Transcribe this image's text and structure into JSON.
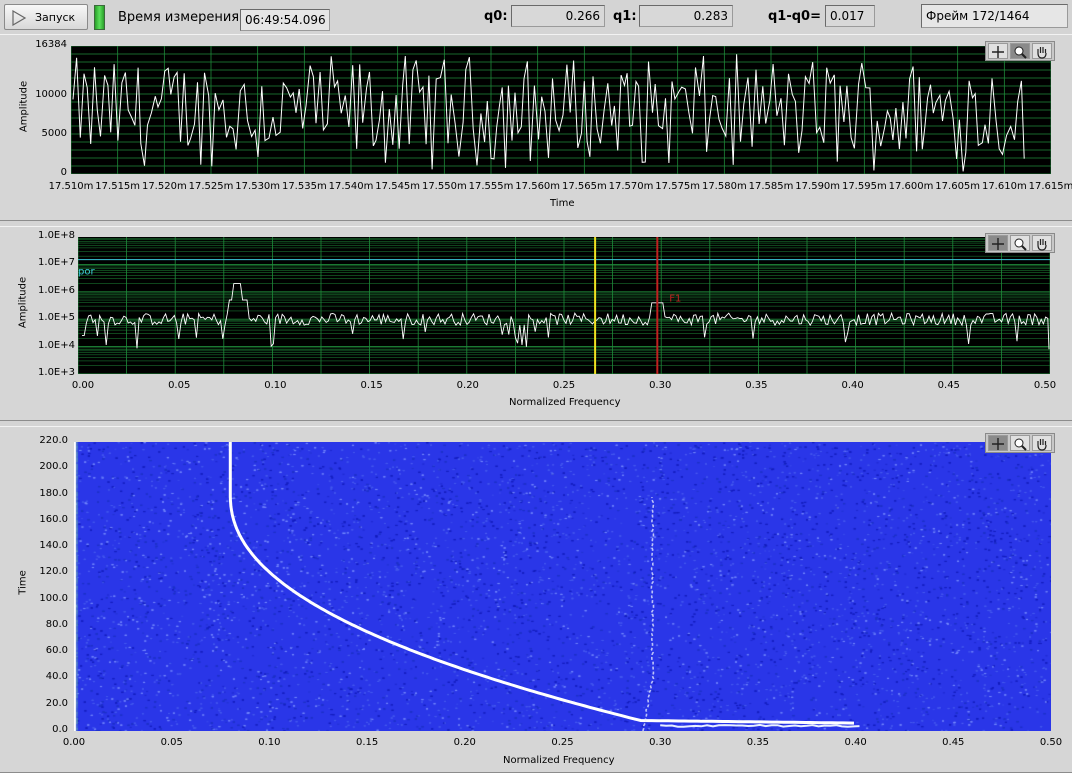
{
  "toolbar": {
    "run_label": "Запуск",
    "run_icon": "play-icon",
    "time_label": "Время измерения:",
    "time_value": "06:49:54.096",
    "q0_label": "q0:",
    "q0_value": "0.266",
    "q1_label": "q1:",
    "q1_value": "0.283",
    "q1q0_label": "q1-q0=",
    "q1q0_value": "0.017",
    "frame_text": "Фрейм 172/1464",
    "led_color": "#4cd44c"
  },
  "palette_icons": [
    "crosshair-icon",
    "zoom-icon",
    "pan-hand-icon"
  ],
  "waveform": {
    "ylabel": "Amplitude",
    "xlabel": "Time",
    "y_ticks": [
      "16384",
      "10000",
      "5000",
      "0"
    ],
    "x_ticks": [
      "17.510m",
      "17.515m",
      "17.520m",
      "17.525m",
      "17.530m",
      "17.535m",
      "17.540m",
      "17.545m",
      "17.550m",
      "17.555m",
      "17.560m",
      "17.565m",
      "17.570m",
      "17.575m",
      "17.580m",
      "17.585m",
      "17.590m",
      "17.595m",
      "17.600m",
      "17.605m",
      "17.610m",
      "17.615m"
    ],
    "trace_color": "#ffffff",
    "grid_color": "#1f8a3a"
  },
  "spectrum": {
    "ylabel": "Amplitude",
    "xlabel": "Normalized Frequency",
    "y_ticks": [
      "1.0E+8",
      "1.0E+7",
      "1.0E+6",
      "1.0E+5",
      "1.0E+4",
      "1.0E+3"
    ],
    "x_ticks": [
      "0.00",
      "0.05",
      "0.10",
      "0.15",
      "0.20",
      "0.25",
      "0.30",
      "0.35",
      "0.40",
      "0.45",
      "0.50"
    ],
    "threshold_label": "por",
    "threshold_value": 15000000,
    "threshold_color": "#3ec8d8",
    "cursor_q0": {
      "value": 0.266,
      "color": "#f0e020"
    },
    "cursor_q1": {
      "value": 0.298,
      "color": "#c02020",
      "label": "F1"
    },
    "peak_freq": 0.082
  },
  "spectrogram": {
    "ylabel": "Time",
    "xlabel": "Normalized Frequency",
    "y_ticks": [
      "220.0",
      "200.0",
      "180.0",
      "160.0",
      "140.0",
      "120.0",
      "100.0",
      "80.0",
      "60.0",
      "40.0",
      "20.0",
      "0.0"
    ],
    "x_ticks": [
      "0.00",
      "0.05",
      "0.10",
      "0.15",
      "0.20",
      "0.25",
      "0.30",
      "0.35",
      "0.40",
      "0.45",
      "0.50"
    ],
    "background_color": "#2a36e8"
  }
}
